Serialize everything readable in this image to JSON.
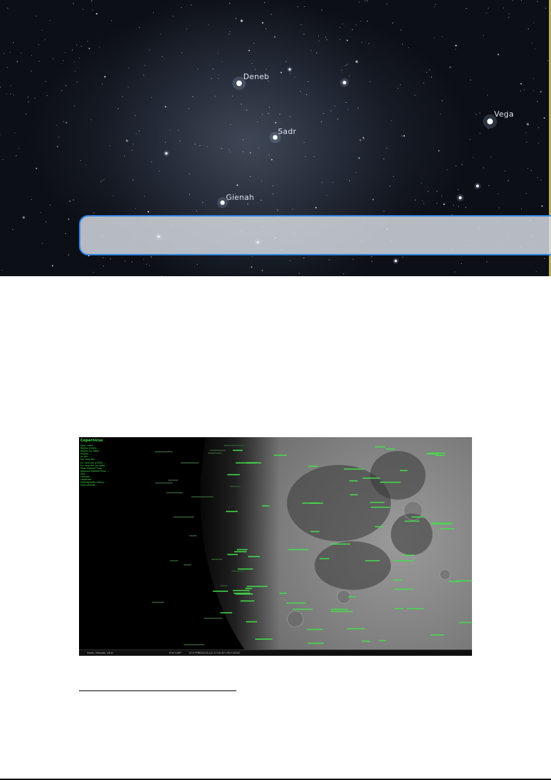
{
  "sky": {
    "stars": {
      "deneb": "Deneb",
      "sadr": "Sadr",
      "vega": "Vega",
      "gienah": "Gienah"
    },
    "search_bar": {
      "value": "",
      "placeholder": ""
    },
    "colors": {
      "search_border": "#2f86e8",
      "label": "#dfe6f0"
    }
  },
  "moon": {
    "info_title": "Copernicus",
    "info_lines": [
      "Type: crater",
      "RA/Dec (J2000): ...",
      "RA/Dec (on date): ...",
      "HA/Dec: ...",
      "Az./Alt.: ...",
      "Gal. long./lat.: ...",
      "Ecl. long./lat. (J2000): ...",
      "Ecl. long./lat. (on date): ...",
      "Mean Sidereal Time: ...",
      "Apparent Sidereal Time: ...",
      "Size: ...",
      "Latitude: ...",
      "Longitude: ...",
      "Selenographic colong.: ...",
      "Solar altitude: ..."
    ],
    "status": {
      "location": "Earth, Helsinki, 16 m",
      "fov": "FOV 0.65°",
      "fps": "13.5 FPS",
      "time": "2023-01-02 17:15:37 UTC+02:00"
    },
    "colors": {
      "label_green": "#43e04a"
    }
  }
}
